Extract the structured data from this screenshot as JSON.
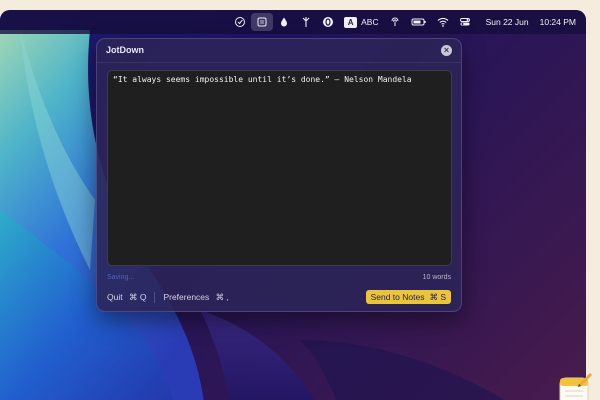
{
  "menubar": {
    "icons": [
      "edit-check-icon",
      "jotdown-menu-icon",
      "drop-icon",
      "fork-icon",
      "o-circle-icon",
      "input-source-icon",
      "airdrop-icon",
      "battery-icon",
      "wifi-icon",
      "control-center-icon"
    ],
    "input_letter": "A",
    "input_label": "ABC",
    "date": "Sun 22 Jun",
    "time": "10:24 PM"
  },
  "panel": {
    "title": "JotDown",
    "close_glyph": "×",
    "text": "“It always seems impossible until it’s done.” — Nelson Mandela",
    "status": "Saving...",
    "word_count": "10 words",
    "quit_label": "Quit",
    "quit_shortcut": "⌘ Q",
    "prefs_label": "Preferences",
    "prefs_shortcut": "⌘ ,",
    "send_label": "Send to Notes",
    "send_shortcut": "⌘ S"
  },
  "colors": {
    "accent": "#e9c43c",
    "status": "#4c63c4",
    "editor_bg": "#1f1f1f"
  }
}
